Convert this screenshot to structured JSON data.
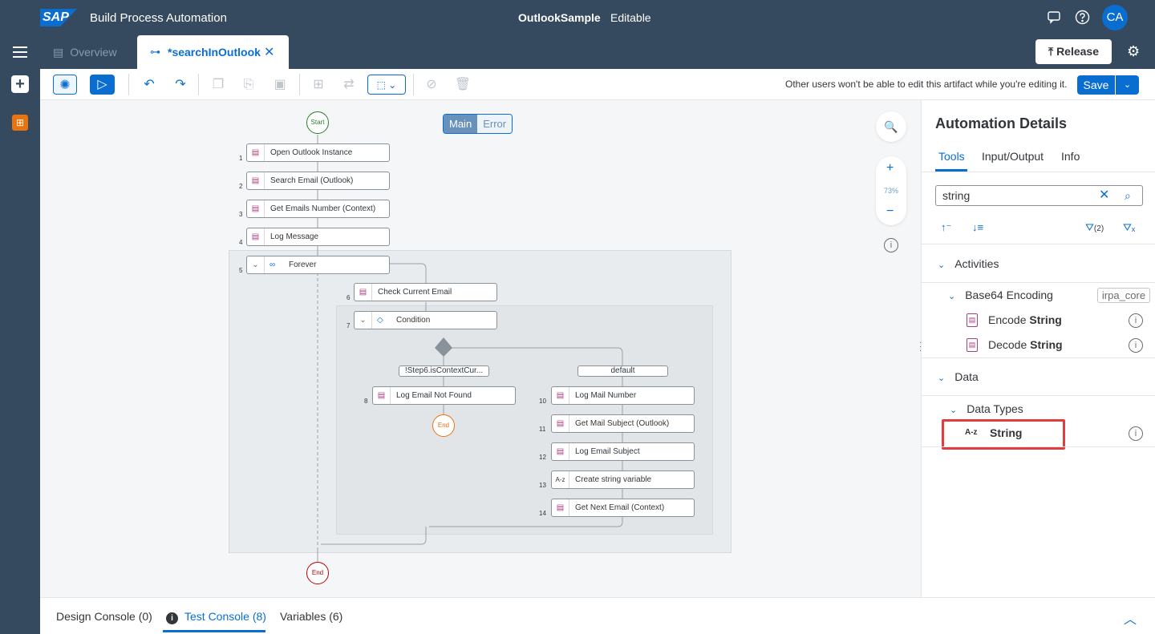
{
  "shell": {
    "logo": "SAP",
    "app_title": "Build Process Automation",
    "project_name": "OutlookSample",
    "project_status": "Editable",
    "avatar_initials": "CA"
  },
  "tabs": {
    "overview": "Overview",
    "active": "*searchInOutlook",
    "release": "Release"
  },
  "toolbar": {
    "edit_note": "Other users won't be able to edit this artifact while you're editing it.",
    "save": "Save"
  },
  "canvas": {
    "mode_main": "Main",
    "mode_error": "Error",
    "zoom_level": "73%",
    "start_label": "Start",
    "end_label": "End",
    "inner_end_label": "End",
    "steps": [
      {
        "num": "1",
        "label": "Open Outlook Instance"
      },
      {
        "num": "2",
        "label": "Search Email (Outlook)"
      },
      {
        "num": "3",
        "label": "Get Emails Number (Context)"
      },
      {
        "num": "4",
        "label": "Log Message"
      },
      {
        "num": "5",
        "label": "Forever"
      },
      {
        "num": "6",
        "label": "Check Current Email"
      },
      {
        "num": "7",
        "label": "Condition"
      },
      {
        "num": "8",
        "label": "Log Email Not Found"
      },
      {
        "num": "10",
        "label": "Log Mail Number"
      },
      {
        "num": "11",
        "label": "Get Mail Subject (Outlook)"
      },
      {
        "num": "12",
        "label": "Log Email Subject"
      },
      {
        "num": "13",
        "label": "Create string variable"
      },
      {
        "num": "14",
        "label": "Get Next Email (Context)"
      }
    ],
    "branch_left": "!Step6.isContextCur...",
    "branch_right": "default"
  },
  "panel": {
    "title": "Automation Details",
    "tabs": [
      "Tools",
      "Input/Output",
      "Info"
    ],
    "search_value": "string",
    "filter_count": "(2)",
    "sections": {
      "activities": "Activities",
      "base64": "Base64 Encoding",
      "base64_tag": "irpa_core",
      "encode_prefix": "Encode ",
      "encode_bold": "String",
      "decode_prefix": "Decode ",
      "decode_bold": "String",
      "data": "Data",
      "data_types": "Data Types",
      "string_type": "String",
      "string_icon": "A-z"
    }
  },
  "bottom": {
    "design_console": "Design Console (0)",
    "test_console": "Test Console (8)",
    "variables": "Variables (6)"
  },
  "colors": {
    "shell_bg": "#354a5f",
    "accent": "#0a6ed1",
    "activity_icon": "#a93e7d",
    "highlight": "#e03e3e"
  }
}
